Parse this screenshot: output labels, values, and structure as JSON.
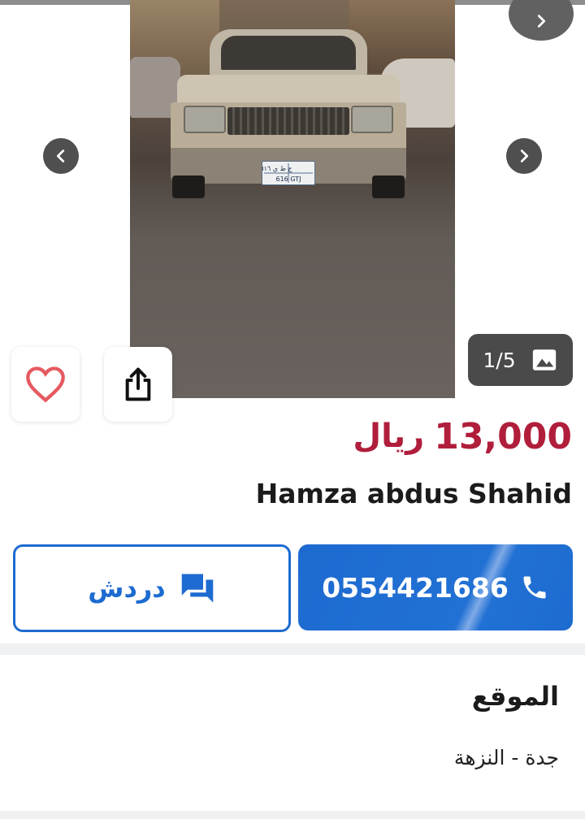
{
  "gallery": {
    "counter_text": "1/5",
    "icon_prev": "chevron-left-icon",
    "icon_next": "chevron-right-icon",
    "icon_image": "image-icon",
    "plate_line1": "ج ط ي ٦١٦",
    "plate_line2": "616 GTJ"
  },
  "actions": {
    "favorite_icon": "heart-icon",
    "share_icon": "share-icon"
  },
  "listing": {
    "price_amount": "13,000",
    "price_currency": "ريال",
    "seller_name": "Hamza abdus Shahid"
  },
  "buttons": {
    "chat_label": "دردش",
    "chat_icon": "chat-icon",
    "phone_number": "0554421686",
    "phone_icon": "phone-icon"
  },
  "location": {
    "title": "الموقع",
    "value": "جدة - النزهة"
  },
  "colors": {
    "price": "#b01e3b",
    "primary": "#1d6bd0",
    "arrow_bg": "#4f4f4f"
  }
}
